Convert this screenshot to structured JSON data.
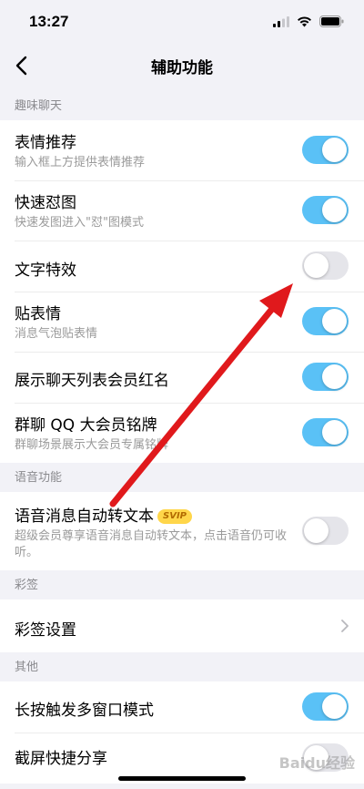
{
  "status_bar": {
    "time": "13:27"
  },
  "nav": {
    "title": "辅助功能"
  },
  "sections": {
    "fun_chat": {
      "header": "趣味聊天",
      "items": [
        {
          "title": "表情推荐",
          "subtitle": "输入框上方提供表情推荐",
          "on": true
        },
        {
          "title": "快速怼图",
          "subtitle": "快速发图进入\"怼\"图模式",
          "on": true
        },
        {
          "title": "文字特效",
          "subtitle": "",
          "on": false
        },
        {
          "title": "贴表情",
          "subtitle": "消息气泡贴表情",
          "on": true
        },
        {
          "title": "展示聊天列表会员红名",
          "subtitle": "",
          "on": true
        },
        {
          "title": "群聊 QQ 大会员铭牌",
          "subtitle": "群聊场景展示大会员专属铭牌",
          "on": true
        }
      ]
    },
    "voice": {
      "header": "语音功能",
      "items": [
        {
          "title": "语音消息自动转文本",
          "badge": "SVIP",
          "subtitle": "超级会员尊享语音消息自动转文本，点击语音仍可收听。",
          "on": false
        }
      ]
    },
    "caiqian": {
      "header": "彩签",
      "items": [
        {
          "title": "彩签设置"
        }
      ]
    },
    "other": {
      "header": "其他",
      "items": [
        {
          "title": "长按触发多窗口模式",
          "on": true
        },
        {
          "title": "截屏快捷分享",
          "on": false
        }
      ]
    }
  },
  "watermark": "Baidu经验",
  "colors": {
    "toggle_on": "#5ac1f6",
    "toggle_off": "#e5e5ea",
    "annotation_arrow": "#e0191c"
  },
  "icons": [
    "back-chevron-icon",
    "signal-icon",
    "wifi-icon",
    "battery-icon",
    "chevron-right-icon"
  ]
}
